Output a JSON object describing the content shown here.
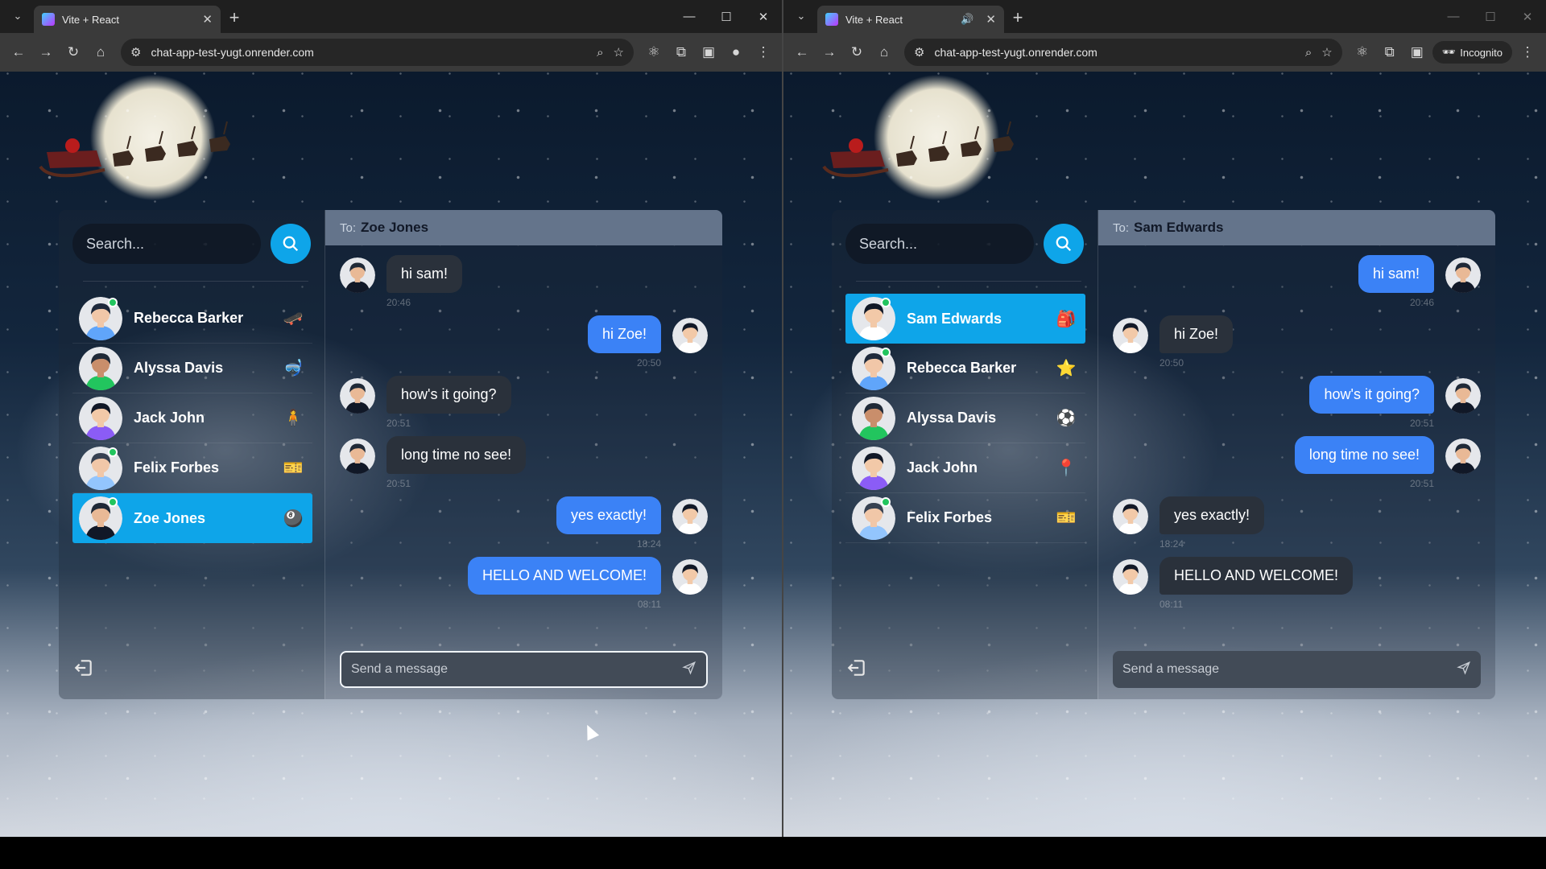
{
  "windows": [
    {
      "tab": {
        "title": "Vite + React",
        "sound_icon": ""
      },
      "url": "chat-app-test-yugt.onrender.com",
      "incognito_label": "",
      "search_placeholder": "Search...",
      "contacts": [
        {
          "name": "Rebecca Barker",
          "emoji": "🛹",
          "online": true,
          "selected": false,
          "skin": "#f1c7a8",
          "hair": "#1e293b",
          "shirt": "#60a5fa"
        },
        {
          "name": "Alyssa Davis",
          "emoji": "🤿",
          "online": false,
          "selected": false,
          "skin": "#c98e6b",
          "hair": "#1f2937",
          "shirt": "#22c55e"
        },
        {
          "name": "Jack John",
          "emoji": "🧍",
          "online": false,
          "selected": false,
          "skin": "#f2c9a8",
          "hair": "#111827",
          "shirt": "#8b5cf6"
        },
        {
          "name": "Felix Forbes",
          "emoji": "🎫",
          "online": true,
          "selected": false,
          "skin": "#f1c7a8",
          "hair": "#374151",
          "shirt": "#93c5fd"
        },
        {
          "name": "Zoe Jones",
          "emoji": "🎱",
          "online": true,
          "selected": true,
          "skin": "#e9b996",
          "hair": "#1f2937",
          "shirt": "#111827"
        }
      ],
      "chat": {
        "to_label": "To:",
        "recipient": "Zoe Jones",
        "composer_placeholder": "Send a message",
        "messages": [
          {
            "text": "hi sam!",
            "time": "20:46",
            "dir": "in",
            "av": "zoe"
          },
          {
            "text": "hi Zoe!",
            "time": "20:50",
            "dir": "out",
            "av": "sam"
          },
          {
            "text": "how's it going?",
            "time": "20:51",
            "dir": "in",
            "av": "zoe"
          },
          {
            "text": "long time no see!",
            "time": "20:51",
            "dir": "in",
            "av": "zoe"
          },
          {
            "text": "yes exactly!",
            "time": "18:24",
            "dir": "out",
            "av": "sam"
          },
          {
            "text": "HELLO AND WELCOME!",
            "time": "08:11",
            "dir": "out",
            "av": "sam"
          }
        ]
      }
    },
    {
      "tab": {
        "title": "Vite + React",
        "sound_icon": "🔊"
      },
      "url": "chat-app-test-yugt.onrender.com",
      "incognito_label": "Incognito",
      "search_placeholder": "Search...",
      "contacts": [
        {
          "name": "Sam Edwards",
          "emoji": "🎒",
          "online": true,
          "selected": true,
          "skin": "#f2c9a8",
          "hair": "#111827",
          "shirt": "#ffffff"
        },
        {
          "name": "Rebecca Barker",
          "emoji": "⭐",
          "online": true,
          "selected": false,
          "skin": "#f1c7a8",
          "hair": "#1e293b",
          "shirt": "#60a5fa"
        },
        {
          "name": "Alyssa Davis",
          "emoji": "⚽",
          "online": false,
          "selected": false,
          "skin": "#c98e6b",
          "hair": "#1f2937",
          "shirt": "#22c55e"
        },
        {
          "name": "Jack John",
          "emoji": "📍",
          "online": false,
          "selected": false,
          "skin": "#f2c9a8",
          "hair": "#111827",
          "shirt": "#8b5cf6"
        },
        {
          "name": "Felix Forbes",
          "emoji": "🎫",
          "online": true,
          "selected": false,
          "skin": "#f1c7a8",
          "hair": "#374151",
          "shirt": "#93c5fd"
        }
      ],
      "chat": {
        "to_label": "To:",
        "recipient": "Sam Edwards",
        "composer_placeholder": "Send a message",
        "messages": [
          {
            "text": "hi sam!",
            "time": "20:46",
            "dir": "out",
            "av": "zoe"
          },
          {
            "text": "hi Zoe!",
            "time": "20:50",
            "dir": "in",
            "av": "sam"
          },
          {
            "text": "how's it going?",
            "time": "20:51",
            "dir": "out",
            "av": "zoe"
          },
          {
            "text": "long time no see!",
            "time": "20:51",
            "dir": "out",
            "av": "zoe"
          },
          {
            "text": "yes exactly!",
            "time": "18:24",
            "dir": "in",
            "av": "sam"
          },
          {
            "text": "HELLO AND WELCOME!",
            "time": "08:11",
            "dir": "in",
            "av": "sam"
          }
        ]
      }
    }
  ],
  "colors": {
    "accent": "#0ea5e9",
    "outgoing": "#3b82f6",
    "incoming": "#2a313b",
    "header": "#64748b",
    "online": "#22c55e"
  },
  "icons": [
    "search-icon",
    "send-icon",
    "logout-icon",
    "back-icon",
    "forward-icon",
    "reload-icon",
    "home-icon",
    "zoom-icon",
    "star-icon",
    "extensions-icon",
    "sidebar-icon",
    "menu-icon",
    "incognito-icon"
  ]
}
